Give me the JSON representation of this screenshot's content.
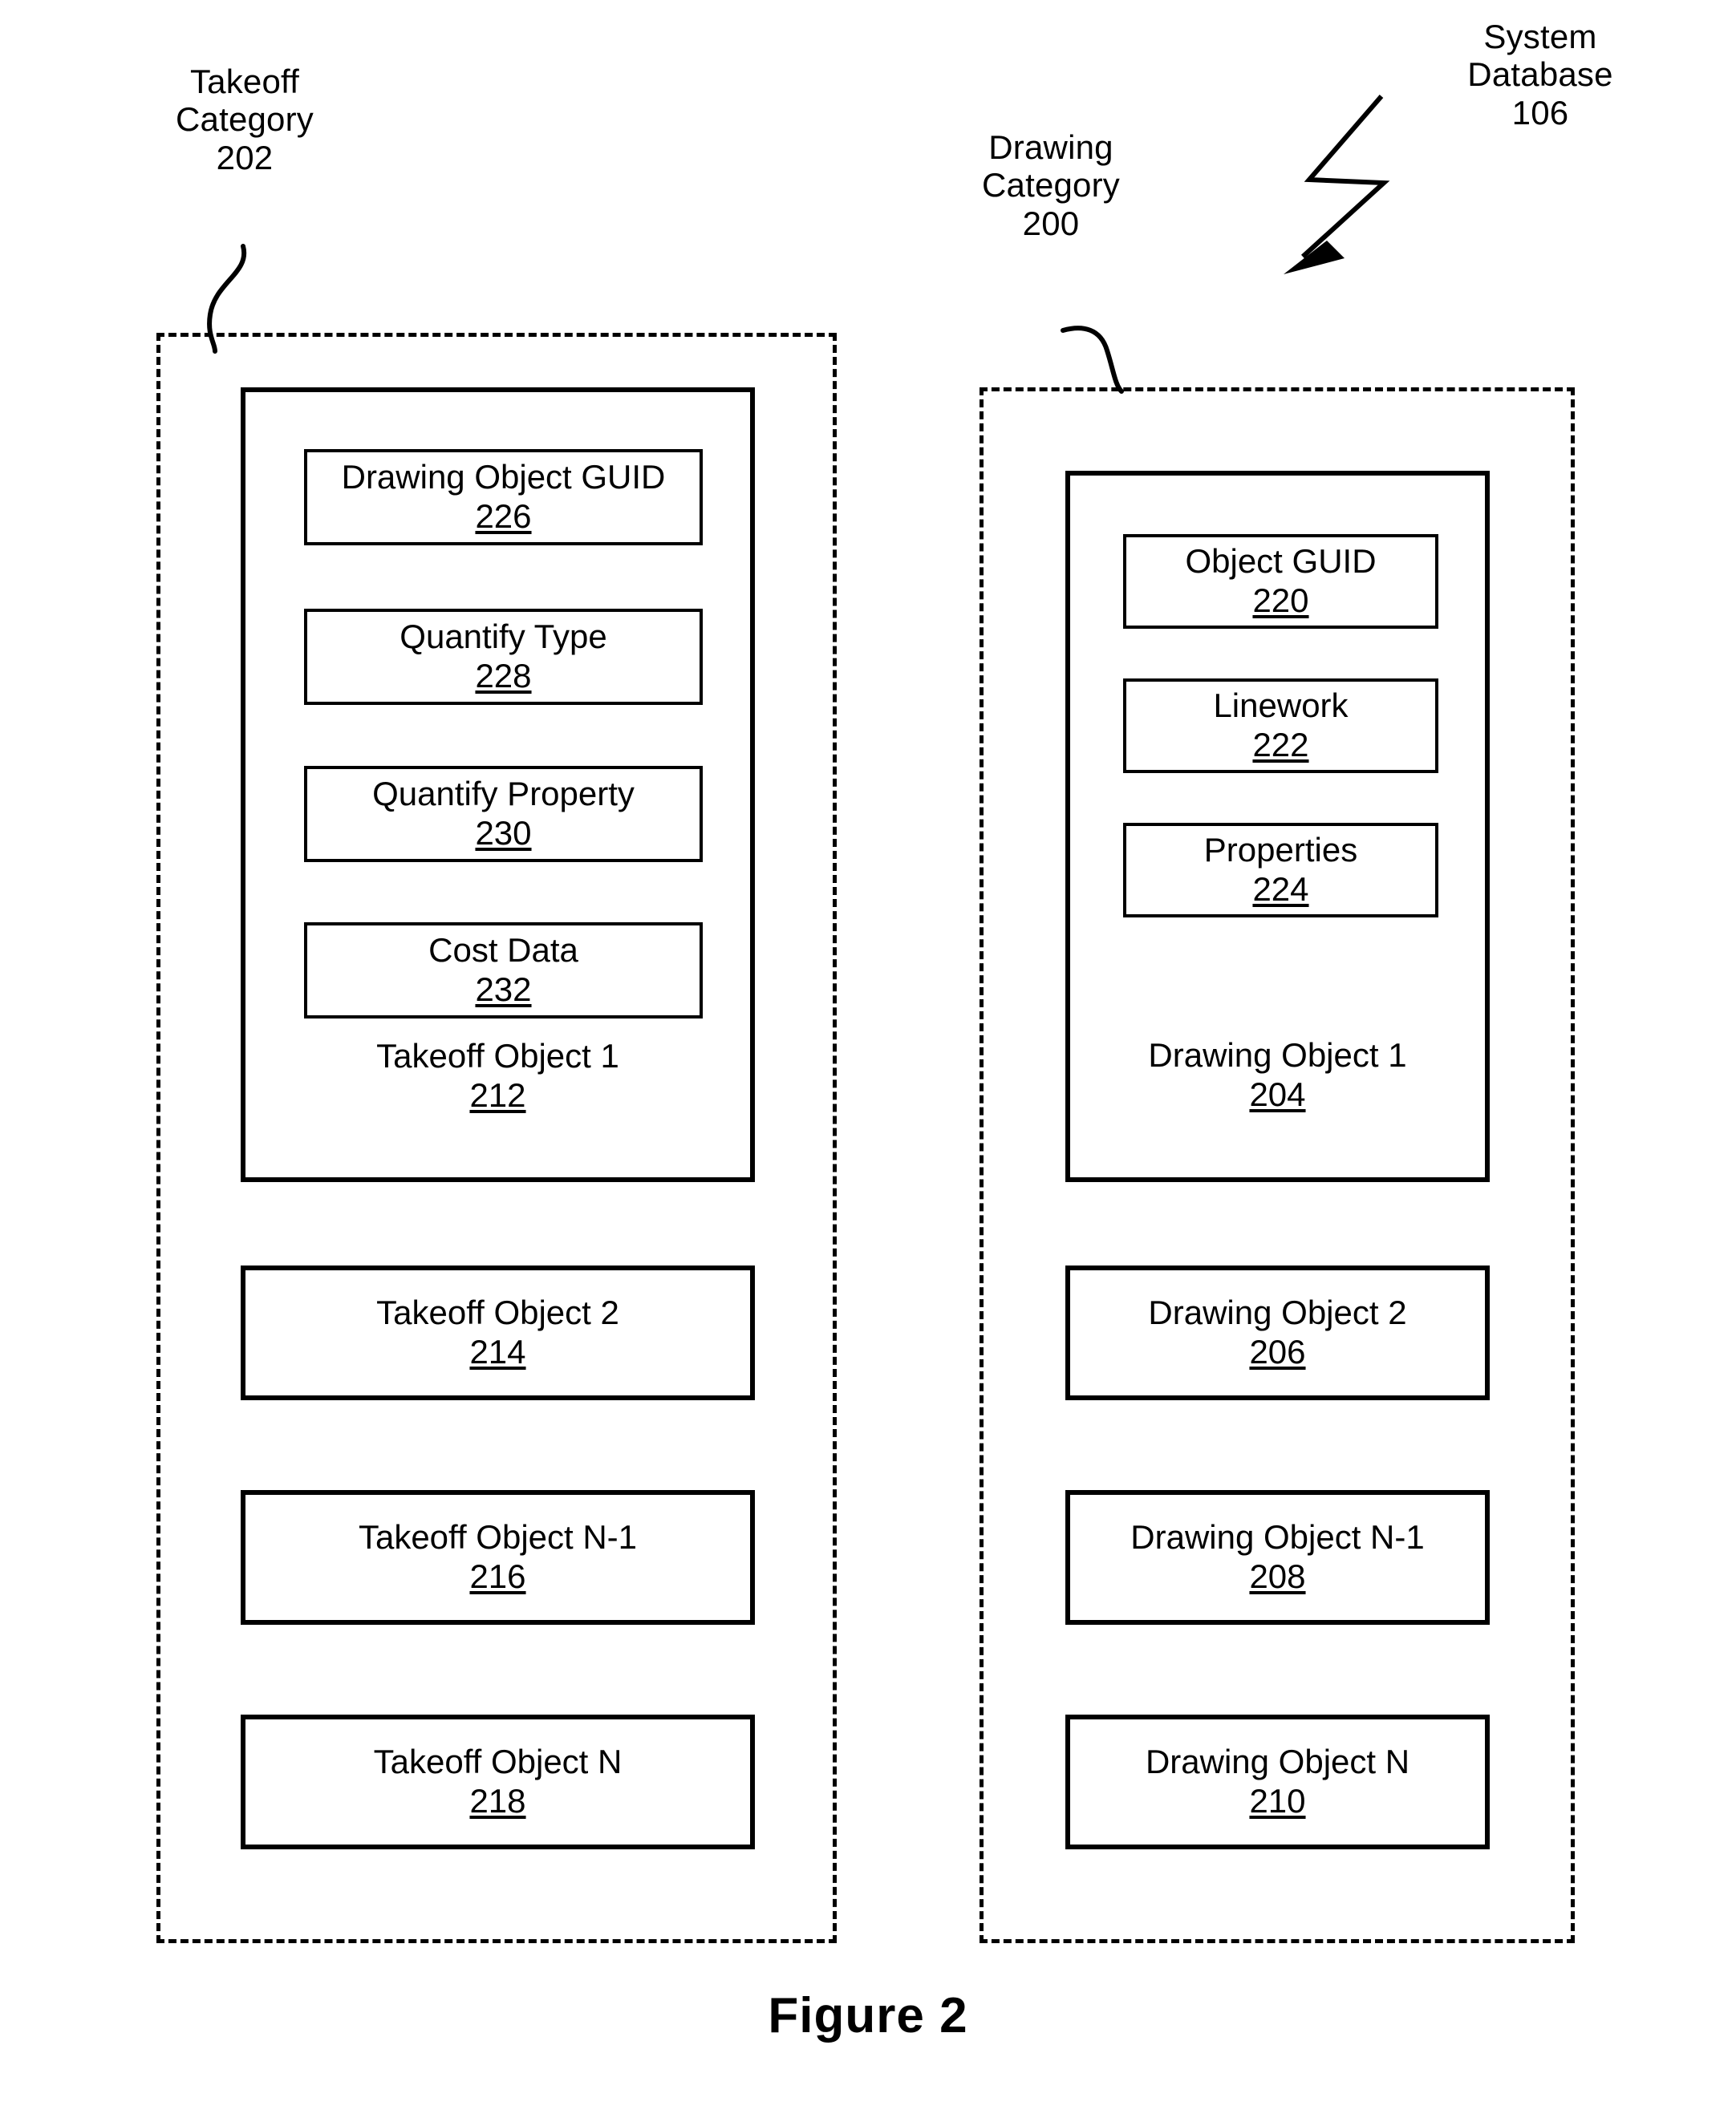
{
  "figure": {
    "caption": "Figure 2"
  },
  "annotations": {
    "system_database": {
      "label": "System\nDatabase\n106",
      "name": "system-database",
      "ref": "106"
    },
    "takeoff_category": {
      "label": "Takeoff\nCategory\n202",
      "name": "takeoff-category",
      "ref": "202"
    },
    "drawing_category": {
      "label": "Drawing\nCategory\n200",
      "name": "drawing-category",
      "ref": "200"
    }
  },
  "takeoff_category": {
    "objects": [
      {
        "title": "Takeoff Object 1",
        "ref": "212",
        "fields": [
          {
            "title": "Drawing Object GUID",
            "ref": "226"
          },
          {
            "title": "Quantify Type",
            "ref": "228"
          },
          {
            "title": "Quantify Property",
            "ref": "230"
          },
          {
            "title": "Cost Data",
            "ref": "232"
          }
        ]
      },
      {
        "title": "Takeoff Object 2",
        "ref": "214",
        "fields": []
      },
      {
        "title": "Takeoff Object N-1",
        "ref": "216",
        "fields": []
      },
      {
        "title": "Takeoff Object N",
        "ref": "218",
        "fields": []
      }
    ]
  },
  "drawing_category": {
    "objects": [
      {
        "title": "Drawing Object 1",
        "ref": "204",
        "fields": [
          {
            "title": "Object GUID",
            "ref": "220"
          },
          {
            "title": "Linework",
            "ref": "222"
          },
          {
            "title": "Properties",
            "ref": "224"
          }
        ]
      },
      {
        "title": "Drawing Object 2",
        "ref": "206",
        "fields": []
      },
      {
        "title": "Drawing Object N-1",
        "ref": "208",
        "fields": []
      },
      {
        "title": "Drawing Object N",
        "ref": "210",
        "fields": []
      }
    ]
  },
  "colors": {
    "ink": "#000000",
    "paper": "#ffffff"
  }
}
